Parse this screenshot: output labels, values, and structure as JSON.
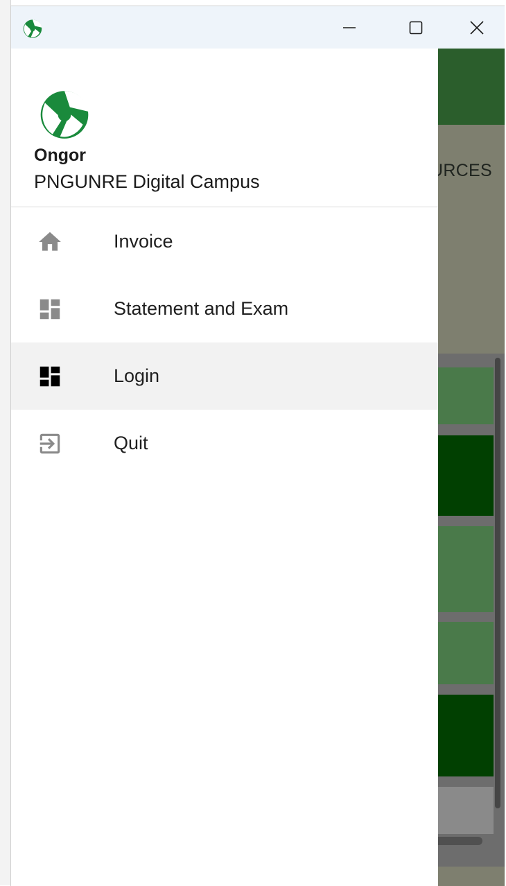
{
  "window": {
    "controls": {
      "minimize_icon": "minimize-icon",
      "maximize_icon": "maximize-icon",
      "close_icon": "close-icon"
    }
  },
  "background": {
    "nav_label_partial": "URCES"
  },
  "drawer": {
    "title": "Ongor",
    "subtitle": "PNGUNRE Digital Campus",
    "items": [
      {
        "label": "Invoice",
        "icon": "home-icon"
      },
      {
        "label": "Statement and Exam",
        "icon": "dashboard-icon"
      },
      {
        "label": "Login",
        "icon": "dashboard-icon",
        "active": true
      },
      {
        "label": "Quit",
        "icon": "exit-icon"
      }
    ]
  },
  "colors": {
    "brand_green": "#1a8a3c",
    "header_green": "#2b5e2c",
    "active_item_bg": "#f2f2f2",
    "tile_green_light": "#4a7a4a",
    "tile_green_dark": "#014001"
  }
}
